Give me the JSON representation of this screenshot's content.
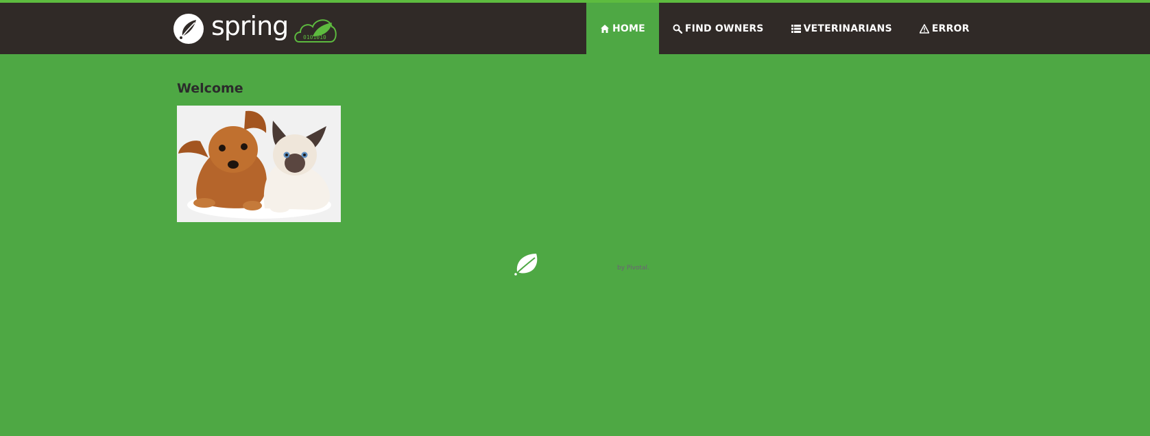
{
  "brand": {
    "name": "spring",
    "cloud_text": "0101010"
  },
  "nav": {
    "items": [
      {
        "label": "HOME",
        "icon": "home-icon",
        "active": true
      },
      {
        "label": "FIND OWNERS",
        "icon": "search-icon",
        "active": false
      },
      {
        "label": "VETERINARIANS",
        "icon": "list-icon",
        "active": false
      },
      {
        "label": "ERROR",
        "icon": "warning-icon",
        "active": false
      }
    ]
  },
  "main": {
    "heading": "Welcome",
    "image": "pets-photo"
  },
  "footer": {
    "logo": "spring-leaf-logo",
    "pivotal_text": "by Pivotal."
  },
  "colors": {
    "navbar": "#302a27",
    "background": "#4ea844",
    "accent": "#5dbb3f",
    "text": "#ffffff"
  }
}
